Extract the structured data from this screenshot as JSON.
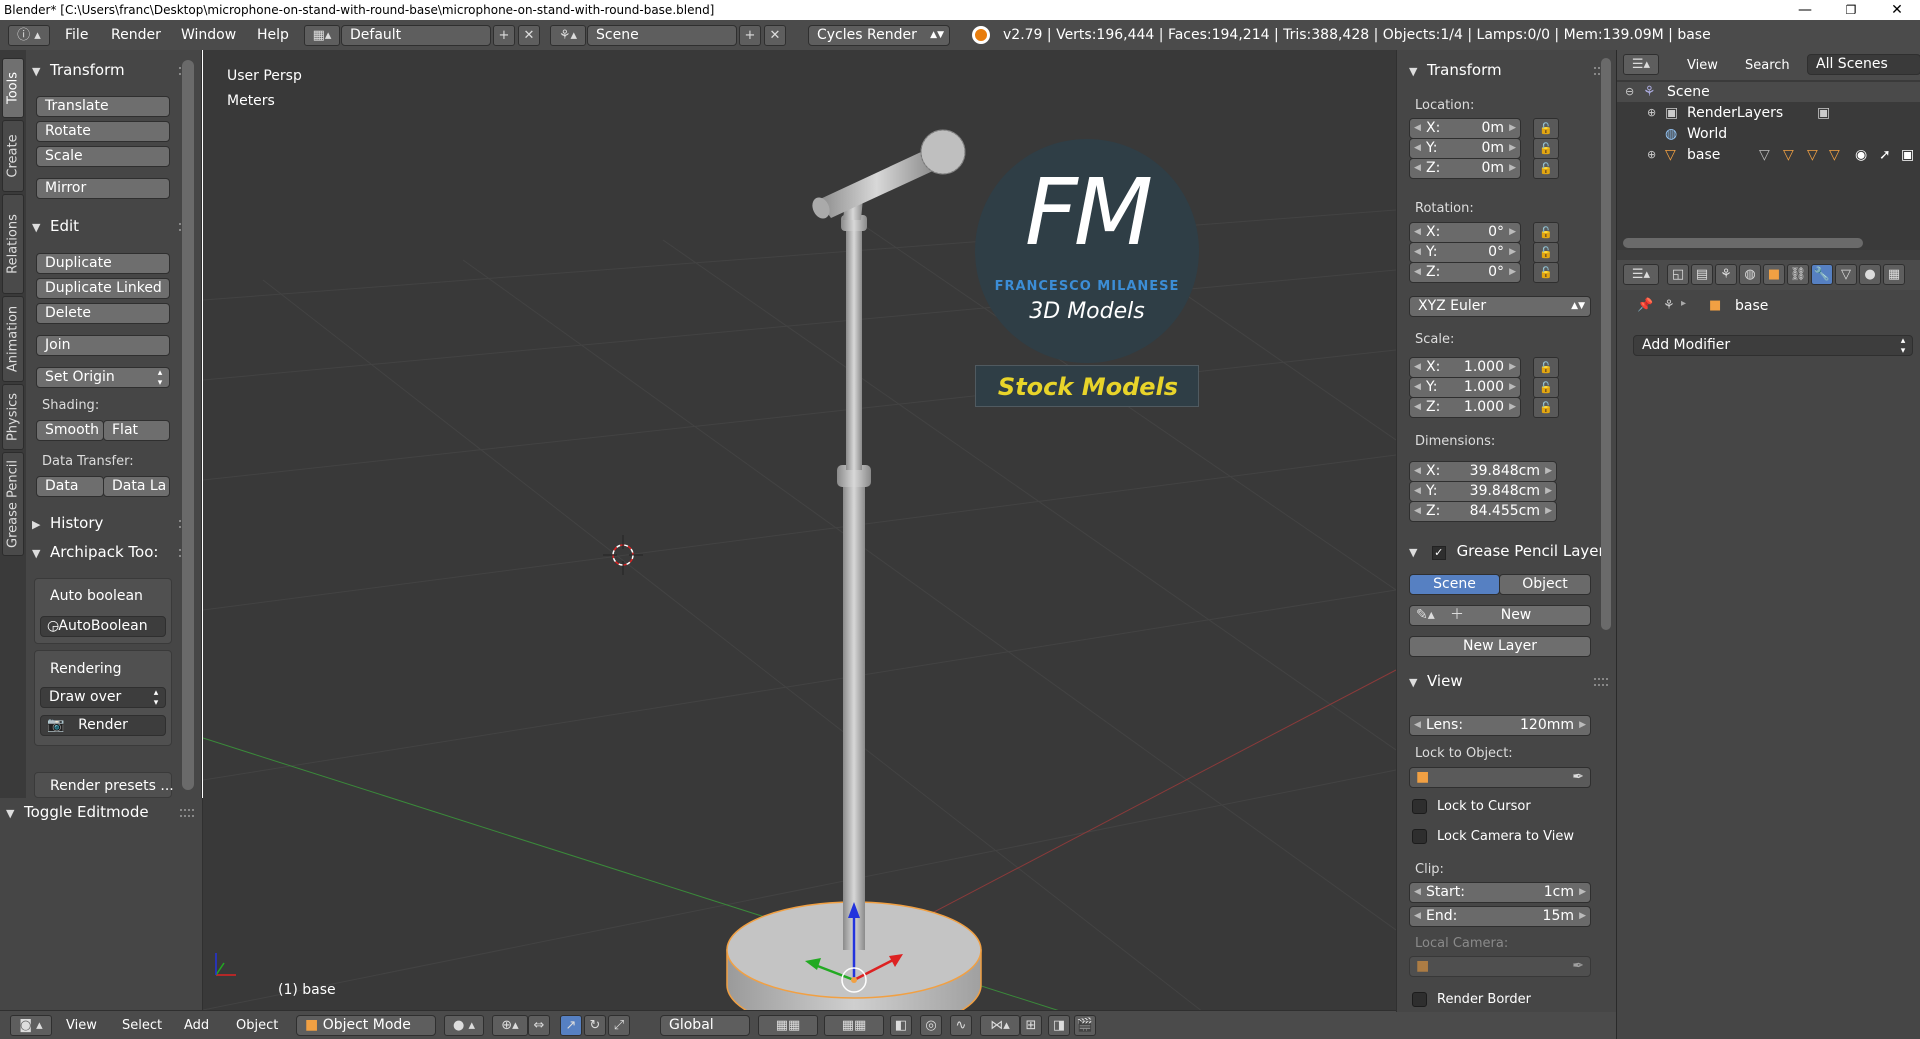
{
  "window": {
    "title": "Blender* [C:\\Users\\franc\\Desktop\\microphone-on-stand-with-round-base\\microphone-on-stand-with-round-base.blend]",
    "minimize": "—",
    "maximize": "❐",
    "close": "✕"
  },
  "info_header": {
    "menus": [
      "File",
      "Render",
      "Window",
      "Help"
    ],
    "screen_layout": "Default",
    "scene": "Scene",
    "render_engine": "Cycles Render",
    "stats": "v2.79 | Verts:196,444 | Faces:194,214 | Tris:388,428 | Objects:1/4 | Lamps:0/0 | Mem:139.09M | base"
  },
  "tool_tabs": [
    "Tools",
    "Create",
    "Relations",
    "Animation",
    "Physics",
    "Grease Pencil"
  ],
  "toolshelf": {
    "transform": {
      "title": "Transform",
      "translate": "Translate",
      "rotate": "Rotate",
      "scale": "Scale",
      "mirror": "Mirror"
    },
    "edit": {
      "title": "Edit",
      "duplicate": "Duplicate",
      "duplicate_linked": "Duplicate Linked",
      "delete": "Delete",
      "join": "Join",
      "set_origin": "Set Origin",
      "shading_label": "Shading:",
      "smooth": "Smooth",
      "flat": "Flat",
      "data_transfer_label": "Data Transfer:",
      "data": "Data",
      "data_layers": "Data La"
    },
    "history": {
      "title": "History"
    },
    "archipack": {
      "title": "Archipack Too:",
      "auto_boolean_label": "Auto boolean",
      "auto_boolean_btn": "AutoBoolean",
      "rendering_label": "Rendering",
      "draw_over": "Draw over",
      "render": "Render",
      "render_presets": "Render presets ..."
    },
    "toggle_editmode": "Toggle Editmode"
  },
  "viewport": {
    "view_name": "User Persp",
    "units": "Meters",
    "object_label": "(1) base",
    "logo_initials": "FM",
    "logo_name": "FRANCESCO MILANESE",
    "logo_sub": "3D Models",
    "banner": "Stock Models"
  },
  "v3d_header": {
    "menus": [
      "View",
      "Select",
      "Add",
      "Object"
    ],
    "mode": "Object Mode",
    "orientation": "Global"
  },
  "npanel": {
    "transform_title": "Transform",
    "location_label": "Location:",
    "location": [
      {
        "axis": "X:",
        "value": "0m"
      },
      {
        "axis": "Y:",
        "value": "0m"
      },
      {
        "axis": "Z:",
        "value": "0m"
      }
    ],
    "rotation_label": "Rotation:",
    "rotation": [
      {
        "axis": "X:",
        "value": "0°"
      },
      {
        "axis": "Y:",
        "value": "0°"
      },
      {
        "axis": "Z:",
        "value": "0°"
      }
    ],
    "rotation_mode": "XYZ Euler",
    "scale_label": "Scale:",
    "scale": [
      {
        "axis": "X:",
        "value": "1.000"
      },
      {
        "axis": "Y:",
        "value": "1.000"
      },
      {
        "axis": "Z:",
        "value": "1.000"
      }
    ],
    "dimensions_label": "Dimensions:",
    "dimensions": [
      {
        "axis": "X:",
        "value": "39.848cm"
      },
      {
        "axis": "Y:",
        "value": "39.848cm"
      },
      {
        "axis": "Z:",
        "value": "84.455cm"
      }
    ],
    "gp_title": "Grease Pencil Layer",
    "gp_scene": "Scene",
    "gp_object": "Object",
    "gp_new": "New",
    "gp_new_layer": "New Layer",
    "view_title": "View",
    "lens_label": "Lens:",
    "lens_value": "120mm",
    "lock_to_object_label": "Lock to Object:",
    "lock_to_cursor": "Lock to Cursor",
    "lock_camera": "Lock Camera to View",
    "clip_label": "Clip:",
    "clip_start_label": "Start:",
    "clip_start": "1cm",
    "clip_end_label": "End:",
    "clip_end": "15m",
    "local_camera_label": "Local Camera:",
    "render_border": "Render Border"
  },
  "outliner": {
    "menus": [
      "View",
      "Search"
    ],
    "filter": "All Scenes",
    "tree": [
      {
        "label": "Scene",
        "depth": 0
      },
      {
        "label": "RenderLayers",
        "depth": 1
      },
      {
        "label": "World",
        "depth": 1
      },
      {
        "label": "base",
        "depth": 1
      }
    ]
  },
  "properties": {
    "breadcrumb_object": "base",
    "add_modifier": "Add Modifier"
  },
  "colors": {
    "background_dark": "#393939",
    "panel": "#464646",
    "active_blue": "#5680c2",
    "selection_orange": "#f1a043",
    "logo_blue": "#3c8dd6",
    "banner_yellow": "#e8d42a"
  }
}
